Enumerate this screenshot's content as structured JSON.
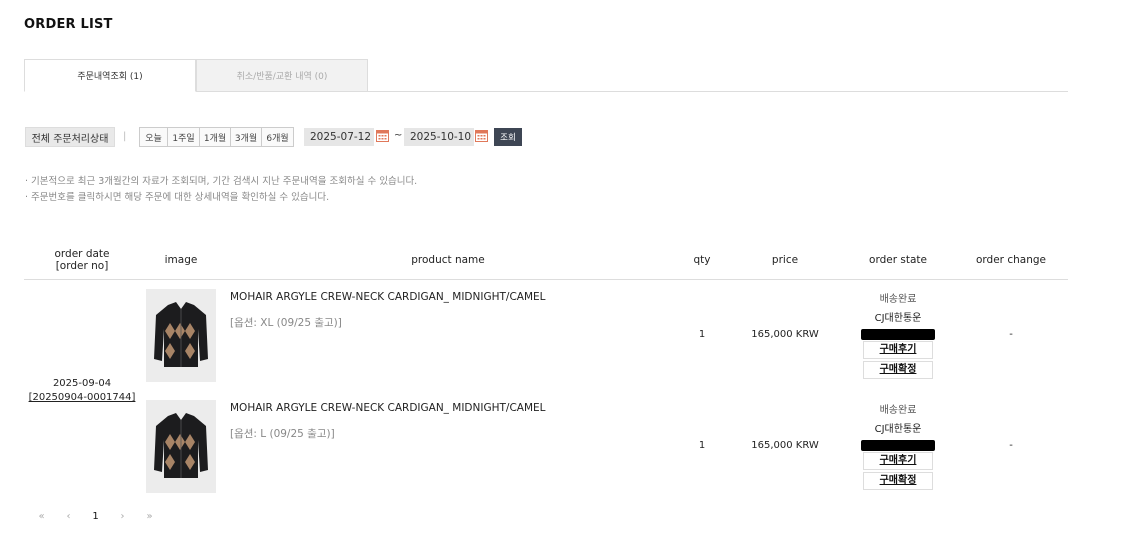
{
  "page": {
    "title": "ORDER LIST"
  },
  "tabs": [
    {
      "label": "주문내역조회 (1)"
    },
    {
      "label": "취소/반품/교환 내역 (0)"
    }
  ],
  "filter": {
    "state": "전체 주문처리상태",
    "separator": "|",
    "periods": [
      "오늘",
      "1주일",
      "1개월",
      "3개월",
      "6개월"
    ],
    "start_date": "2025-07-12",
    "end_date": "2025-10-10",
    "range_sep": "~",
    "search_label": "조회"
  },
  "notes": [
    "· 기본적으로 최근 3개월간의 자료가 조회되며, 기간 검색시 지난 주문내역을 조회하실 수 있습니다.",
    "· 주문번호를 클릭하시면 해당 주문에 대한 상세내역을 확인하실 수 있습니다."
  ],
  "table": {
    "headers": {
      "order_date": "order date",
      "order_no": "[order no]",
      "image": "image",
      "product": "product name",
      "qty": "qty",
      "price": "price",
      "state": "order state",
      "change": "order change"
    },
    "order": {
      "date": "2025-09-04",
      "number": "[20250904-0001744]"
    },
    "items": [
      {
        "name": "MOHAIR ARGYLE CREW-NECK CARDIGAN_ MIDNIGHT/CAMEL",
        "option": "[옵션: XL (09/25 출고)]",
        "qty": "1",
        "price": "165,000 KRW",
        "state": "배송완료",
        "carrier": "CJ대한통운",
        "review_label": "구매후기",
        "confirm_label": "구매확정",
        "change": "-"
      },
      {
        "name": "MOHAIR ARGYLE CREW-NECK CARDIGAN_ MIDNIGHT/CAMEL",
        "option": "[옵션: L (09/25 출고)]",
        "qty": "1",
        "price": "165,000 KRW",
        "state": "배송완료",
        "carrier": "CJ대한통운",
        "review_label": "구매후기",
        "confirm_label": "구매확정",
        "change": "-"
      }
    ]
  },
  "pagination": {
    "first": "«",
    "prev": "‹",
    "current": "1",
    "next": "›",
    "last": "»"
  },
  "colors": {
    "search_button": "#3e4654",
    "calendar_icon": "#e0785a",
    "tab_inactive_bg": "#f2f2f2"
  }
}
